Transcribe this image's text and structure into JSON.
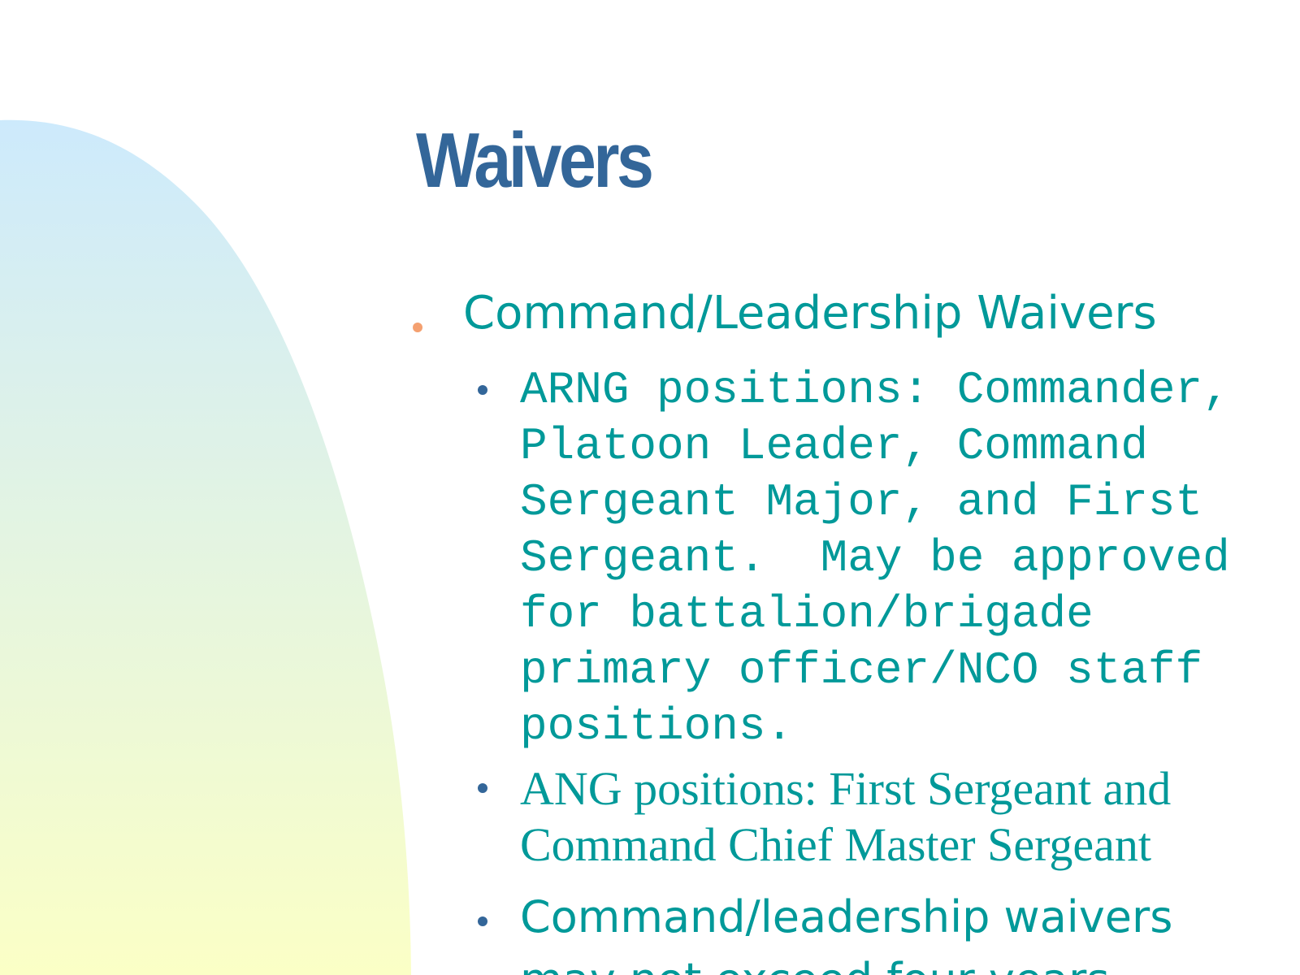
{
  "slide": {
    "title": "Waivers",
    "colors": {
      "title": "#336699",
      "body_text": "#009999",
      "level1_bullet": "#f4a070",
      "level2_bullet": "#336699",
      "gradient_top": "#cdeafc",
      "gradient_bottom": "#fbffc6"
    },
    "heading_item": {
      "text": "Command/Leadership Waivers"
    },
    "sub_items": [
      {
        "text": "ARNG positions: Commander, Platoon Leader, Command Sergeant Major, and First Sergeant.  May be approved for battalion/brigade primary officer/NCO staff positions."
      },
      {
        "text": "ANG positions: First Sergeant and Command Chief Master Sergeant"
      },
      {
        "text": "Command/leadership waivers\nmay not exceed four years"
      }
    ]
  }
}
